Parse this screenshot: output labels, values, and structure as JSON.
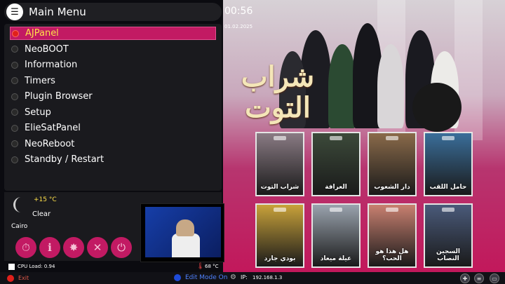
{
  "header": {
    "title": "Main Menu",
    "menu_icon": "menu-list-icon"
  },
  "clock": {
    "time": "00:56",
    "date": "01.02.2025"
  },
  "menu": {
    "items": [
      {
        "label": "AJPanel",
        "selected": true
      },
      {
        "label": "NeoBOOT"
      },
      {
        "label": "Information"
      },
      {
        "label": "Timers"
      },
      {
        "label": "Plugin Browser"
      },
      {
        "label": "Setup"
      },
      {
        "label": "ElieSatPanel"
      },
      {
        "label": "NeoReboot"
      },
      {
        "label": "Standby / Restart"
      }
    ]
  },
  "weather": {
    "temperature": "+15 °C",
    "condition": "Clear",
    "city": "Cairo",
    "icon": "moon-icon"
  },
  "quick_buttons": [
    {
      "icon": "timer-icon",
      "glyph": "⏱"
    },
    {
      "icon": "info-icon",
      "glyph": "ℹ"
    },
    {
      "icon": "plugins-icon",
      "glyph": "✸"
    },
    {
      "icon": "tools-icon",
      "glyph": "✕"
    },
    {
      "icon": "power-icon",
      "glyph": "⏻"
    }
  ],
  "featured": {
    "arabic_title_line1": "شراب",
    "arabic_title_line2": "التوت"
  },
  "posters": [
    {
      "title": "شراب التوت",
      "color": "#8a7b84"
    },
    {
      "title": "العرافة",
      "color": "#3c4a3a"
    },
    {
      "title": "دار الشعوب",
      "color": "#8a6a4a"
    },
    {
      "title": "حامل اللقب",
      "color": "#3a6e9a"
    },
    {
      "title": "بودي جارد",
      "color": "#c9a23a"
    },
    {
      "title": "عيلة ميعاد",
      "color": "#9aa3ae"
    },
    {
      "title": "هل هذا هو الحب؟",
      "color": "#c98070"
    },
    {
      "title": "السجين النصاب",
      "color": "#4a5a7a"
    }
  ],
  "status": {
    "cpu": "CPU Load: 0.94",
    "cpu_temp": "68 °C"
  },
  "bottom": {
    "exit_label": "Exit",
    "edit_mode_label": "Edit Mode On",
    "ip_label": "IP:",
    "ip_value": "192.168.1.3",
    "colors": {
      "red": "#e0201b",
      "blue": "#1e4bd8",
      "accent": "#c21a63"
    }
  }
}
